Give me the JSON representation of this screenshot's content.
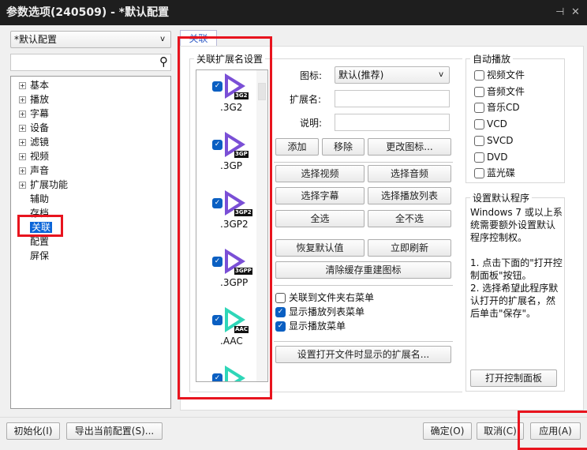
{
  "window": {
    "title": "参数选项(240509) - *默认配置",
    "pin_icon": "pin-icon",
    "close_icon": "close-icon"
  },
  "profile": {
    "selected": "*默认配置"
  },
  "search": {
    "value": "",
    "placeholder": ""
  },
  "tree": [
    {
      "label": "基本",
      "expandable": true
    },
    {
      "label": "播放",
      "expandable": true
    },
    {
      "label": "字幕",
      "expandable": true
    },
    {
      "label": "设备",
      "expandable": true
    },
    {
      "label": "滤镜",
      "expandable": true
    },
    {
      "label": "视频",
      "expandable": true
    },
    {
      "label": "声音",
      "expandable": true
    },
    {
      "label": "扩展功能",
      "expandable": true
    },
    {
      "label": "辅助",
      "expandable": false
    },
    {
      "label": "存档",
      "expandable": false
    },
    {
      "label": "关联",
      "expandable": false,
      "selected": true
    },
    {
      "label": "配置",
      "expandable": false
    },
    {
      "label": "屏保",
      "expandable": false
    }
  ],
  "tab": {
    "label": "关联"
  },
  "ext_group": {
    "title": "关联扩展名设置",
    "items": [
      {
        "ext": ".3G2",
        "badge": "3G2",
        "checked": true,
        "color": "#7a4fd6"
      },
      {
        "ext": ".3GP",
        "badge": "3GP",
        "checked": true,
        "color": "#7a4fd6"
      },
      {
        "ext": ".3GP2",
        "badge": "3GP2",
        "checked": true,
        "color": "#7a4fd6"
      },
      {
        "ext": ".3GPP",
        "badge": "3GPP",
        "checked": true,
        "color": "#7a4fd6"
      },
      {
        "ext": ".AAC",
        "badge": "AAC",
        "checked": true,
        "color": "#2fd6b8"
      },
      {
        "ext": "",
        "badge": "",
        "checked": true,
        "color": "#2fd6b8"
      }
    ]
  },
  "form": {
    "icon_label": "图标:",
    "icon_value": "默认(推荐)",
    "ext_label": "扩展名:",
    "ext_value": "",
    "desc_label": "说明:",
    "desc_value": ""
  },
  "buttons": {
    "add": "添加",
    "remove": "移除",
    "change_icon": "更改图标...",
    "sel_video": "选择视频",
    "sel_audio": "选择音频",
    "sel_sub": "选择字幕",
    "sel_playlist": "选择播放列表",
    "sel_all": "全选",
    "sel_none": "全不选",
    "restore": "恢复默认值",
    "refresh": "立即刷新",
    "clear_cache": "清除缓存重建图标",
    "set_open_ext": "设置打开文件时显示的扩展名..."
  },
  "options": [
    {
      "label": "关联到文件夹右菜单",
      "checked": false
    },
    {
      "label": "显示播放列表菜单",
      "checked": true
    },
    {
      "label": "显示播放菜单",
      "checked": true
    }
  ],
  "autoplay": {
    "title": "自动播放",
    "items": [
      {
        "label": "视频文件",
        "checked": false
      },
      {
        "label": "音频文件",
        "checked": false
      },
      {
        "label": "音乐CD",
        "checked": false
      },
      {
        "label": "VCD",
        "checked": false
      },
      {
        "label": "SVCD",
        "checked": false
      },
      {
        "label": "DVD",
        "checked": false
      },
      {
        "label": "蓝光碟",
        "checked": false
      }
    ]
  },
  "default_prog": {
    "title": "设置默认程序",
    "text1": "Windows 7 或以上系统需要额外设置默认程序控制权。",
    "text2": "1. 点击下面的\"打开控制面板\"按钮。",
    "text3": "2. 选择希望此程序默认打开的扩展名，然后单击\"保存\"。",
    "button": "打开控制面板"
  },
  "footer": {
    "init": "初始化(I)",
    "export": "导出当前配置(S)...",
    "ok": "确定(O)",
    "cancel": "取消(C)",
    "apply": "应用(A)"
  },
  "colors": {
    "accent": "#0a5fc2",
    "highlight": "#e8141e",
    "titlebar": "#1e1e1e"
  }
}
